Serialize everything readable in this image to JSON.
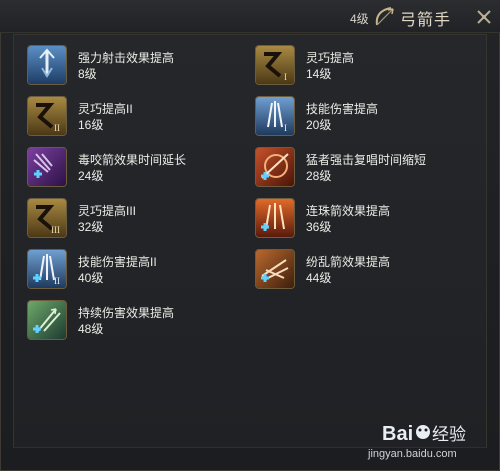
{
  "header": {
    "level": "4级",
    "class_name": "弓箭手"
  },
  "skills": [
    {
      "name": "强力射击效果提高",
      "level": "8级",
      "icon": "power-shot-icon"
    },
    {
      "name": "灵巧提高",
      "level": "14级",
      "icon": "dexterity-icon"
    },
    {
      "name": "灵巧提高II",
      "level": "16级",
      "icon": "dexterity-ii-icon"
    },
    {
      "name": "技能伤害提高",
      "level": "20级",
      "icon": "skill-damage-icon"
    },
    {
      "name": "毒咬箭效果时间延长",
      "level": "24级",
      "icon": "poison-arrow-icon"
    },
    {
      "name": "猛者强击复唱时间缩短",
      "level": "28级",
      "icon": "fierce-strike-icon"
    },
    {
      "name": "灵巧提高III",
      "level": "32级",
      "icon": "dexterity-iii-icon"
    },
    {
      "name": "连珠箭效果提高",
      "level": "36级",
      "icon": "barrage-arrow-icon"
    },
    {
      "name": "技能伤害提高II",
      "level": "40级",
      "icon": "skill-damage-ii-icon"
    },
    {
      "name": "纷乱箭效果提高",
      "level": "44级",
      "icon": "chaos-arrow-icon"
    },
    {
      "name": "持续伤害效果提高",
      "level": "48级",
      "icon": "dot-damage-icon"
    }
  ],
  "watermark": {
    "logo": "Baidu经验",
    "url": "jingyan.baidu.com"
  }
}
